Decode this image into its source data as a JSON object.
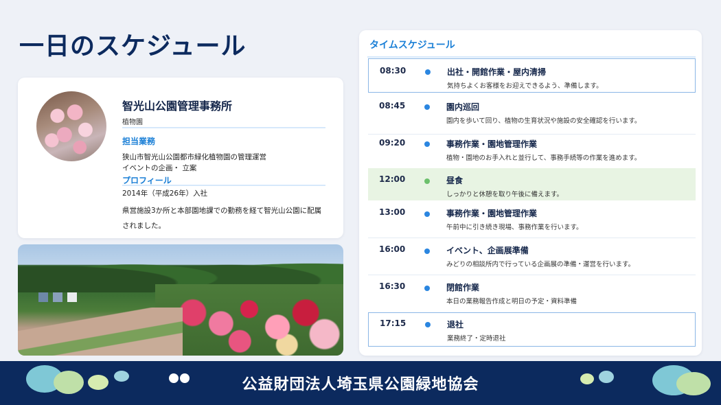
{
  "page": {
    "title": "一日のスケジュール"
  },
  "profile": {
    "avatar_icon": "cherry-blossom-photo",
    "name": "智光山公園管理事務所",
    "subtitle": "植物園",
    "duties_heading": "担当業務",
    "duties": [
      "狭山市智光山公園都市緑化植物園の管理運営",
      "イベントの企画・ 立案"
    ],
    "profile_heading": "プロフィール",
    "joined": "2014年（平成26年）入社",
    "bio": "県営施設3か所と本部園地課での勤務を経て智光山公園に配属されました。"
  },
  "photo": {
    "icon": "rose-garden-photo"
  },
  "schedule": {
    "heading": "タイムスケジュール",
    "items": [
      {
        "time": "08:30",
        "title": "出社・開館作業・屋内清掃",
        "desc": "気持ちよくお客様をお迎えできるよう、準備します。"
      },
      {
        "time": "08:45",
        "title": "園内巡回",
        "desc": "園内を歩いて回り、植物の生育状況や施設の安全確認を行います。"
      },
      {
        "time": "09:20",
        "title": "事務作業・園地管理作業",
        "desc": "植物・園地のお手入れと並行して、事務手続等の作業を進めます。"
      },
      {
        "time": "12:00",
        "title": "昼食",
        "desc": "しっかりと休憩を取り午後に備えます。"
      },
      {
        "time": "13:00",
        "title": "事務作業・園地管理作業",
        "desc": "午前中に引き続き現場、事務作業を行います。"
      },
      {
        "time": "16:00",
        "title": "イベント、企画展準備",
        "desc": "みどりの相談所内で行っている企画展の準備・運営を行います。"
      },
      {
        "time": "16:30",
        "title": "閉館作業",
        "desc": "本日の業務報告作成と明日の予定・資料準備"
      },
      {
        "time": "17:15",
        "title": "退社",
        "desc": "業務終了・定時退社"
      }
    ]
  },
  "footer": {
    "org": "公益財団法人埼玉県公園緑地協会"
  },
  "colors": {
    "navy": "#0c2a5e",
    "accent_blue": "#1a7fd6",
    "dot_blue": "#2b86e0",
    "lunch_green": "#e8f4e3"
  }
}
